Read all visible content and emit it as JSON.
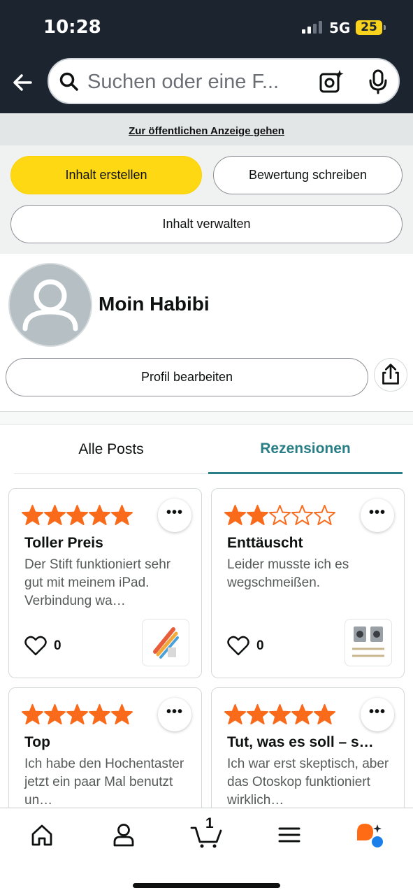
{
  "status_bar": {
    "time": "10:28",
    "network": "5G",
    "battery": "25"
  },
  "search": {
    "placeholder": "Suchen oder eine F..."
  },
  "public_link": "Zur öffentlichen Anzeige gehen",
  "actions": {
    "create": "Inhalt erstellen",
    "review": "Bewertung schreiben",
    "manage": "Inhalt verwalten"
  },
  "profile": {
    "name": "Moin Habibi",
    "edit": "Profil bearbeiten"
  },
  "tabs": [
    {
      "label": "Alle Posts",
      "active": false
    },
    {
      "label": "Rezensionen",
      "active": true
    }
  ],
  "reviews": [
    {
      "rating": 5,
      "title": "Toller Preis",
      "text": "Der Stift funktioniert sehr gut mit meinem iPad. Verbindung wa…",
      "likes": "0",
      "thumb_icon": "stylus-pen-image"
    },
    {
      "rating": 2,
      "title": "Enttäuscht",
      "text": "Leider musste ich es wegschmeißen.",
      "likes": "0",
      "thumb_icon": "cables-and-chargers-image"
    },
    {
      "rating": 5,
      "title": "Top",
      "text": "Ich habe den Hochentaster jetzt ein paar Mal benutzt un…",
      "likes": "",
      "thumb_icon": ""
    },
    {
      "rating": 5,
      "title": "Tut, was es soll – s…",
      "text": "Ich war erst skeptisch, aber das Otoskop funktioniert wirklich…",
      "likes": "",
      "thumb_icon": ""
    }
  ],
  "more_label": "•••",
  "bottom_nav": {
    "items": [
      "home-icon",
      "account-icon",
      "cart-icon",
      "menu-icon",
      "rufus-ai-icon"
    ],
    "cart_count": "1"
  },
  "colors": {
    "header": "#1c2430",
    "accent_yellow": "#ffd814",
    "star": "#f96a1b",
    "tab_accent": "#2a7f86"
  }
}
